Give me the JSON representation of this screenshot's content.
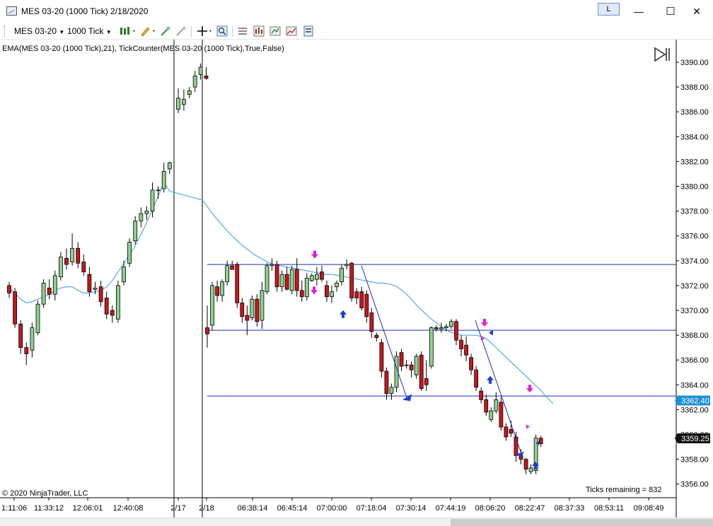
{
  "window": {
    "title": "MES 03-20 (1000 Tick)  2/18/2020",
    "l_button": "L",
    "minimize": "—",
    "maximize": "☐",
    "close": "✕"
  },
  "toolbar": {
    "instrument": "MES 03-20",
    "interval": "1000 Tick",
    "icons": [
      "bar-style-icon",
      "drawing-tool-icon",
      "pencil-icon",
      "crosshair-icon",
      "zoom-icon",
      "chart-properties-icon",
      "strategy-icon",
      "data-box-icon",
      "indicator-icon"
    ]
  },
  "indicator_label": "EMA(MES 03-20 (1000 Tick),21), TickCounter(MES 03-20 (1000 Tick),True,False)",
  "copyright": "© 2020 NinjaTrader, LLC",
  "ticks_remaining": "Ticks remaining = 832",
  "price_axis": {
    "ticks": [
      "3390.00",
      "3388.00",
      "3386.00",
      "3384.00",
      "3382.00",
      "3380.00",
      "3378.00",
      "3376.00",
      "3374.00",
      "3372.00",
      "3370.00",
      "3368.00",
      "3366.00",
      "3364.00",
      "3362.00",
      "3360.00",
      "3358.00",
      "3356.00"
    ],
    "badges": [
      {
        "label": "3362.40",
        "bg": "#1e90d8",
        "fg": "#ffffff"
      },
      {
        "label": "3359.25",
        "bg": "#111111",
        "fg": "#ffffff"
      }
    ]
  },
  "time_axis": {
    "ticks": [
      "1:11:06",
      "11:33:12",
      "12:06:01",
      "12:40:08",
      "2/17",
      "2/18",
      "06:38:14",
      "06:45:14",
      "07:00:00",
      "07:18:04",
      "07:30:14",
      "07:44:19",
      "08:06:20",
      "08:22:47",
      "08:37:33",
      "08:53:11",
      "09:08:49"
    ]
  },
  "colors": {
    "up_candle": "#8fd18f",
    "down_candle": "#c8161d",
    "ema": "#4aa3e0",
    "hline": "#1f2fb0",
    "arrow_up": "#1a3cd6",
    "arrow_down": "#e020d0"
  },
  "chart_data": {
    "type": "candlestick",
    "instrument": "MES 03-20",
    "interval": "1000 Tick",
    "ylim": [
      3356,
      3391
    ],
    "horizontal_lines": [
      3373.7,
      3368.4,
      3363.1
    ],
    "candles": [
      [
        3372.0,
        3372.3,
        3371.0,
        3371.4
      ],
      [
        3371.5,
        3371.8,
        3368.6,
        3368.9
      ],
      [
        3368.9,
        3369.2,
        3366.5,
        3367.0
      ],
      [
        3367.0,
        3367.4,
        3365.6,
        3366.5
      ],
      [
        3366.8,
        3369.0,
        3366.2,
        3368.6
      ],
      [
        3368.2,
        3370.8,
        3368.0,
        3370.5
      ],
      [
        3370.5,
        3372.5,
        3370.2,
        3372.2
      ],
      [
        3371.8,
        3372.5,
        3370.9,
        3371.3
      ],
      [
        3371.3,
        3373.2,
        3370.8,
        3372.8
      ],
      [
        3372.7,
        3374.7,
        3372.4,
        3374.3
      ],
      [
        3374.2,
        3375.0,
        3373.3,
        3373.7
      ],
      [
        3373.9,
        3376.2,
        3373.6,
        3375.0
      ],
      [
        3375.0,
        3375.5,
        3373.4,
        3373.8
      ],
      [
        3373.9,
        3374.5,
        3372.8,
        3373.1
      ],
      [
        3372.9,
        3373.5,
        3371.1,
        3371.5
      ],
      [
        3371.7,
        3372.3,
        3371.3,
        3371.8
      ],
      [
        3371.9,
        3372.4,
        3370.3,
        3370.7
      ],
      [
        3371.0,
        3371.5,
        3369.3,
        3369.7
      ],
      [
        3370.0,
        3370.4,
        3369.0,
        3369.6
      ],
      [
        3369.3,
        3372.4,
        3369.0,
        3372.0
      ],
      [
        3372.3,
        3374.0,
        3372.0,
        3373.5
      ],
      [
        3373.8,
        3375.8,
        3373.5,
        3375.5
      ],
      [
        3375.6,
        3377.6,
        3375.3,
        3377.2
      ],
      [
        3377.2,
        3378.3,
        3376.7,
        3377.8
      ],
      [
        3377.8,
        3378.4,
        3377.3,
        3378.0
      ],
      [
        3378.0,
        3380.3,
        3377.5,
        3379.7
      ],
      [
        3379.7,
        3380.0,
        3379.0,
        3379.7
      ],
      [
        3379.8,
        3381.9,
        3379.5,
        3381.2
      ],
      [
        3381.4,
        3382.0,
        3381.0,
        3381.9
      ],
      [
        3386.2,
        3387.9,
        3385.9,
        3387.1
      ],
      [
        3386.6,
        3387.8,
        3386.1,
        3387.0
      ],
      [
        3387.4,
        3388.0,
        3387.1,
        3387.7
      ],
      [
        3388.0,
        3389.3,
        3387.6,
        3388.9
      ],
      [
        3389.0,
        3389.9,
        3388.6,
        3389.6
      ],
      [
        3388.9,
        3389.6,
        3388.6,
        3388.7
      ],
      [
        3368.6,
        3370.4,
        3367.0,
        3368.1
      ],
      [
        3368.8,
        3372.3,
        3368.4,
        3372.0
      ],
      [
        3371.9,
        3372.4,
        3370.7,
        3371.2
      ],
      [
        3371.2,
        3372.5,
        3370.7,
        3372.3
      ],
      [
        3372.3,
        3374.0,
        3372.0,
        3373.6
      ],
      [
        3373.6,
        3374.0,
        3373.3,
        3373.3
      ],
      [
        3373.7,
        3373.9,
        3370.2,
        3370.6
      ],
      [
        3370.6,
        3371.0,
        3369.0,
        3369.5
      ],
      [
        3369.6,
        3370.4,
        3368.0,
        3369.2
      ],
      [
        3369.4,
        3371.2,
        3369.2,
        3370.9
      ],
      [
        3370.9,
        3371.3,
        3368.7,
        3369.1
      ],
      [
        3369.2,
        3372.3,
        3368.5,
        3371.6
      ],
      [
        3371.5,
        3373.8,
        3371.3,
        3373.6
      ],
      [
        3373.6,
        3374.2,
        3373.2,
        3373.7
      ],
      [
        3373.7,
        3374.0,
        3371.5,
        3371.9
      ],
      [
        3371.9,
        3373.2,
        3371.5,
        3372.9
      ],
      [
        3372.9,
        3373.5,
        3371.6,
        3371.7
      ],
      [
        3371.6,
        3373.6,
        3371.3,
        3373.3
      ],
      [
        3373.3,
        3374.2,
        3371.1,
        3371.6
      ],
      [
        3371.6,
        3372.4,
        3370.7,
        3371.1
      ],
      [
        3371.1,
        3373.0,
        3370.8,
        3372.6
      ],
      [
        3372.4,
        3373.0,
        3372.3,
        3372.8
      ],
      [
        3372.5,
        3373.5,
        3372.0,
        3372.9
      ],
      [
        3373.1,
        3373.6,
        3372.3,
        3372.5
      ],
      [
        3372.0,
        3372.4,
        3370.7,
        3371.1
      ],
      [
        3371.1,
        3372.0,
        3370.6,
        3371.5
      ],
      [
        3371.9,
        3372.4,
        3371.5,
        3372.2
      ],
      [
        3372.3,
        3373.7,
        3372.0,
        3373.4
      ],
      [
        3373.6,
        3374.1,
        3373.3,
        3373.7
      ],
      [
        3373.8,
        3373.9,
        3370.7,
        3371.0
      ],
      [
        3371.5,
        3371.8,
        3370.5,
        3371.0
      ],
      [
        3371.5,
        3371.9,
        3370.0,
        3370.2
      ],
      [
        3371.3,
        3371.6,
        3369.0,
        3369.5
      ],
      [
        3369.8,
        3370.2,
        3367.8,
        3368.3
      ],
      [
        3368.0,
        3368.2,
        3367.5,
        3367.8
      ],
      [
        3367.4,
        3367.7,
        3364.6,
        3365.1
      ],
      [
        3365.1,
        3365.4,
        3362.8,
        3363.3
      ],
      [
        3363.3,
        3364.1,
        3362.8,
        3363.8
      ],
      [
        3363.8,
        3366.7,
        3363.4,
        3366.3
      ],
      [
        3366.6,
        3366.9,
        3365.1,
        3365.5
      ],
      [
        3365.6,
        3366.0,
        3365.3,
        3365.6
      ],
      [
        3365.6,
        3365.9,
        3364.6,
        3365.2
      ],
      [
        3364.8,
        3366.5,
        3364.5,
        3366.3
      ],
      [
        3366.4,
        3366.7,
        3363.5,
        3363.7
      ],
      [
        3364.5,
        3366.0,
        3363.5,
        3364.0
      ],
      [
        3365.5,
        3368.7,
        3365.3,
        3368.6
      ],
      [
        3368.6,
        3368.8,
        3368.3,
        3368.5
      ],
      [
        3368.5,
        3369.0,
        3368.2,
        3368.6
      ],
      [
        3368.6,
        3368.9,
        3368.3,
        3368.7
      ],
      [
        3368.7,
        3369.3,
        3368.5,
        3369.1
      ],
      [
        3369.1,
        3369.3,
        3367.2,
        3367.6
      ],
      [
        3367.6,
        3368.0,
        3366.3,
        3366.9
      ],
      [
        3367.2,
        3367.9,
        3365.9,
        3366.4
      ],
      [
        3366.2,
        3366.5,
        3364.8,
        3365.2
      ],
      [
        3365.2,
        3365.5,
        3363.5,
        3363.8
      ],
      [
        3363.5,
        3363.8,
        3362.5,
        3362.8
      ],
      [
        3362.8,
        3363.2,
        3361.5,
        3361.8
      ],
      [
        3361.2,
        3362.2,
        3361.0,
        3361.9
      ],
      [
        3361.9,
        3363.4,
        3361.7,
        3362.8
      ],
      [
        3362.6,
        3363.0,
        3360.3,
        3360.6
      ],
      [
        3360.6,
        3360.9,
        3359.5,
        3359.8
      ],
      [
        3360.4,
        3361.1,
        3359.8,
        3360.1
      ],
      [
        3359.8,
        3360.2,
        3357.8,
        3358.3
      ],
      [
        3358.3,
        3358.8,
        3357.6,
        3358.0
      ],
      [
        3358.0,
        3358.1,
        3356.8,
        3357.2
      ],
      [
        3357.0,
        3357.6,
        3356.8,
        3357.3
      ],
      [
        3357.1,
        3360.0,
        3356.8,
        3359.7
      ],
      [
        3359.7,
        3359.9,
        3359.0,
        3359.25
      ]
    ],
    "ema": [
      3371.8,
      3371.4,
      3370.9,
      3370.6,
      3370.7,
      3370.9,
      3371.1,
      3371.3,
      3371.6,
      3371.8,
      3371.9,
      3371.9,
      3371.6,
      3371.4,
      3371.4,
      3371.5,
      3371.6,
      3371.9,
      3372.4,
      3373.1,
      3373.8,
      3374.5,
      3375.2,
      3376.1,
      3377.1,
      3378.1,
      3379.2,
      3380.3,
      3379.6,
      3378.9,
      3378.2,
      3377.5,
      3376.9,
      3376.3,
      3375.8,
      3375.3,
      3374.9,
      3374.5,
      3374.2,
      3373.9,
      3373.7,
      3373.6,
      3373.5,
      3373.4,
      3373.3,
      3373.2,
      3373.1,
      3373.0,
      3372.9,
      3372.9,
      3372.8,
      3372.7,
      3372.6,
      3372.5,
      3372.4,
      3372.3,
      3372.2,
      3372.2,
      3372.1,
      3371.9,
      3371.5,
      3371.0,
      3370.4,
      3369.9,
      3369.4,
      3369.0,
      3368.6,
      3368.3,
      3368.1,
      3368.0,
      3368.0,
      3368.0,
      3367.9,
      3367.6,
      3367.1,
      3366.6,
      3366.1,
      3365.6,
      3365.1,
      3364.6,
      3364.1,
      3363.6,
      3363.0,
      3362.5
    ],
    "ema_x_start_index": 0
  }
}
